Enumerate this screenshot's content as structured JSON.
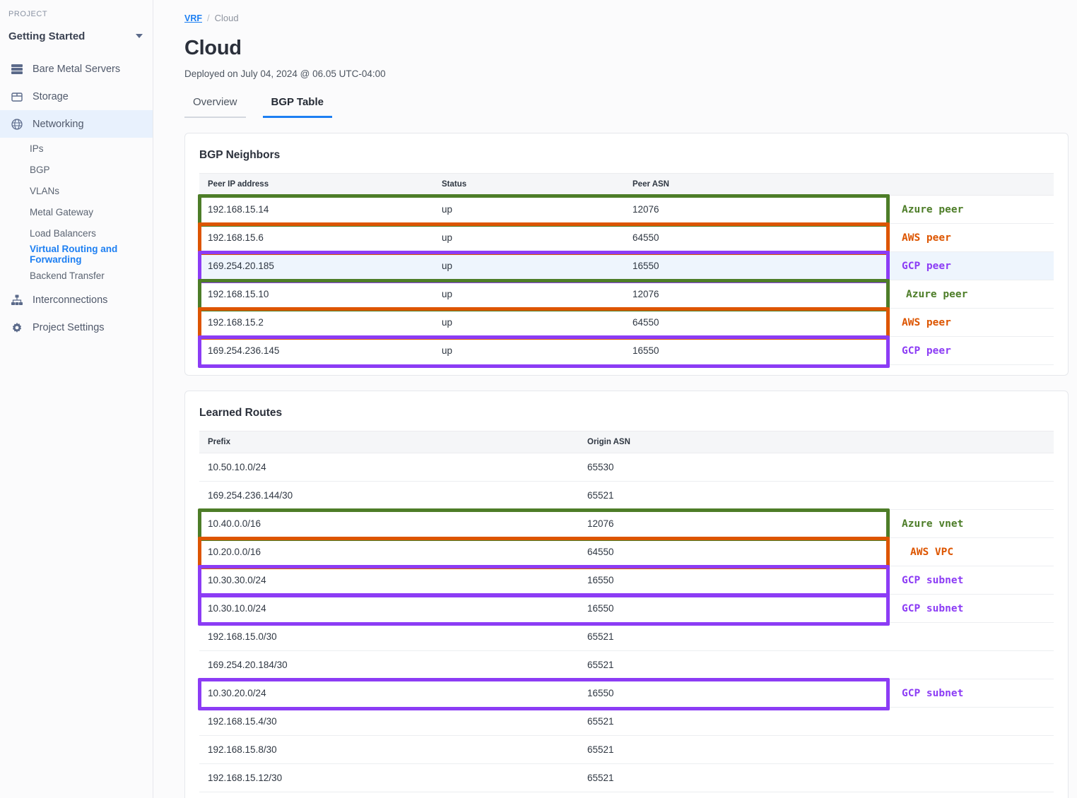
{
  "sidebar": {
    "project_label": "PROJECT",
    "project_name": "Getting Started",
    "nav": [
      {
        "label": "Bare Metal Servers",
        "icon": "server-icon"
      },
      {
        "label": "Storage",
        "icon": "storage-icon"
      },
      {
        "label": "Networking",
        "icon": "globe-icon"
      }
    ],
    "subnav": [
      {
        "label": "IPs"
      },
      {
        "label": "BGP"
      },
      {
        "label": "VLANs"
      },
      {
        "label": "Metal Gateway"
      },
      {
        "label": "Load Balancers"
      },
      {
        "label": "Virtual Routing and Forwarding"
      },
      {
        "label": "Backend Transfer"
      }
    ],
    "nav_bottom": [
      {
        "label": "Interconnections",
        "icon": "sitemap-icon"
      },
      {
        "label": "Project Settings",
        "icon": "gear-icon"
      }
    ]
  },
  "breadcrumb": {
    "root": "VRF",
    "separator": "/",
    "current": "Cloud"
  },
  "page": {
    "title": "Cloud",
    "deployed": "Deployed on July 04, 2024 @ 06.05 UTC-04:00"
  },
  "tabs": [
    {
      "label": "Overview",
      "active": false
    },
    {
      "label": "BGP Table",
      "active": true
    }
  ],
  "colors": {
    "azure_green": "#4d7d28",
    "aws_orange": "#dd5500",
    "gcp_purple": "#8c3cf5",
    "accent_blue": "#1d7ff2",
    "row_highlight": "#eef5fd"
  },
  "bgp_neighbors": {
    "title": "BGP Neighbors",
    "columns": [
      "Peer IP address",
      "Status",
      "Peer ASN",
      ""
    ],
    "rows": [
      {
        "peer_ip": "192.168.15.14",
        "status": "up",
        "peer_asn": "12076",
        "note": "Azure peer",
        "color": "azure_green",
        "row_hl": false
      },
      {
        "peer_ip": "192.168.15.6",
        "status": "up",
        "peer_asn": "64550",
        "note": "AWS peer",
        "color": "aws_orange",
        "row_hl": false
      },
      {
        "peer_ip": "169.254.20.185",
        "status": "up",
        "peer_asn": "16550",
        "note": "GCP peer",
        "color": "gcp_purple",
        "row_hl": true
      },
      {
        "peer_ip": "192.168.15.10",
        "status": "up",
        "peer_asn": "12076",
        "note": "Azure peer",
        "color": "azure_green",
        "row_hl": false
      },
      {
        "peer_ip": "192.168.15.2",
        "status": "up",
        "peer_asn": "64550",
        "note": "AWS peer",
        "color": "aws_orange",
        "row_hl": false
      },
      {
        "peer_ip": "169.254.236.145",
        "status": "up",
        "peer_asn": "16550",
        "note": "GCP peer",
        "color": "gcp_purple",
        "row_hl": false
      }
    ]
  },
  "learned_routes": {
    "title": "Learned Routes",
    "columns": [
      "Prefix",
      "Origin ASN",
      ""
    ],
    "rows": [
      {
        "prefix": "10.50.10.0/24",
        "origin_asn": "65530",
        "note": "",
        "color": ""
      },
      {
        "prefix": "169.254.236.144/30",
        "origin_asn": "65521",
        "note": "",
        "color": ""
      },
      {
        "prefix": "10.40.0.0/16",
        "origin_asn": "12076",
        "note": "Azure vnet",
        "color": "azure_green"
      },
      {
        "prefix": "10.20.0.0/16",
        "origin_asn": "64550",
        "note": "AWS VPC",
        "color": "aws_orange"
      },
      {
        "prefix": "10.30.30.0/24",
        "origin_asn": "16550",
        "note": "GCP subnet",
        "color": "gcp_purple"
      },
      {
        "prefix": "10.30.10.0/24",
        "origin_asn": "16550",
        "note": "GCP subnet",
        "color": "gcp_purple"
      },
      {
        "prefix": "192.168.15.0/30",
        "origin_asn": "65521",
        "note": "",
        "color": ""
      },
      {
        "prefix": "169.254.20.184/30",
        "origin_asn": "65521",
        "note": "",
        "color": ""
      },
      {
        "prefix": "10.30.20.0/24",
        "origin_asn": "16550",
        "note": "GCP subnet",
        "color": "gcp_purple"
      },
      {
        "prefix": "192.168.15.4/30",
        "origin_asn": "65521",
        "note": "",
        "color": ""
      },
      {
        "prefix": "192.168.15.8/30",
        "origin_asn": "65521",
        "note": "",
        "color": ""
      },
      {
        "prefix": "192.168.15.12/30",
        "origin_asn": "65521",
        "note": "",
        "color": ""
      }
    ]
  }
}
